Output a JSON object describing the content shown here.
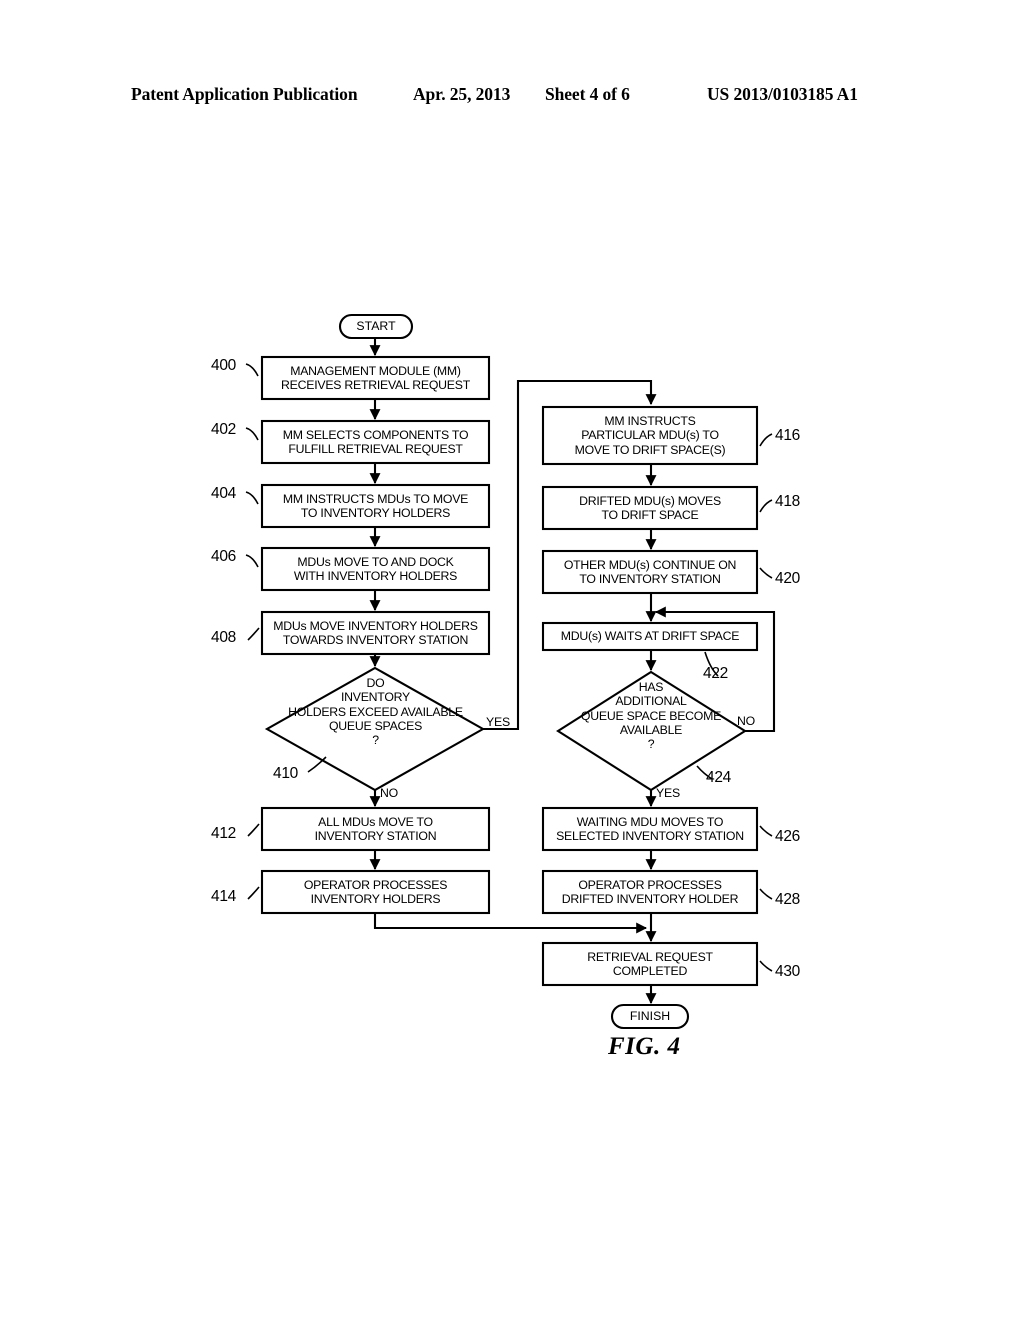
{
  "header": {
    "publication": "Patent Application Publication",
    "date": "Apr. 25, 2013",
    "sheet": "Sheet 4 of 6",
    "doc_number": "US 2013/0103185 A1"
  },
  "figure": {
    "caption": "FIG. 4",
    "start_label": "START",
    "finish_label": "FINISH"
  },
  "chart_data": {
    "type": "diagram",
    "title": "FIG. 4",
    "nodes": [
      {
        "ref": "",
        "shape": "terminal",
        "lines": [
          "START"
        ]
      },
      {
        "ref": "400",
        "shape": "process",
        "lines": [
          "MANAGEMENT MODULE (MM)",
          "RECEIVES RETRIEVAL REQUEST"
        ]
      },
      {
        "ref": "402",
        "shape": "process",
        "lines": [
          "MM SELECTS COMPONENTS TO",
          "FULFILL RETRIEVAL REQUEST"
        ]
      },
      {
        "ref": "404",
        "shape": "process",
        "lines": [
          "MM INSTRUCTS MDUs TO MOVE",
          "TO INVENTORY HOLDERS"
        ]
      },
      {
        "ref": "406",
        "shape": "process",
        "lines": [
          "MDUs MOVE TO AND DOCK",
          "WITH INVENTORY HOLDERS"
        ]
      },
      {
        "ref": "408",
        "shape": "process",
        "lines": [
          "MDUs MOVE INVENTORY HOLDERS",
          "TOWARDS INVENTORY STATION"
        ]
      },
      {
        "ref": "410",
        "shape": "decision",
        "lines": [
          "DO",
          "INVENTORY",
          "HOLDERS EXCEED AVAILABLE",
          "QUEUE SPACES",
          "?"
        ]
      },
      {
        "ref": "412",
        "shape": "process",
        "lines": [
          "ALL MDUs MOVE TO",
          "INVENTORY STATION"
        ]
      },
      {
        "ref": "414",
        "shape": "process",
        "lines": [
          "OPERATOR PROCESSES",
          "INVENTORY HOLDERS"
        ]
      },
      {
        "ref": "416",
        "shape": "process",
        "lines": [
          "MM INSTRUCTS",
          "PARTICULAR MDU(s) TO",
          "MOVE TO DRIFT SPACE(S)"
        ]
      },
      {
        "ref": "418",
        "shape": "process",
        "lines": [
          "DRIFTED MDU(s) MOVES",
          "TO DRIFT SPACE"
        ]
      },
      {
        "ref": "420",
        "shape": "process",
        "lines": [
          "OTHER MDU(s) CONTINUE ON",
          "TO INVENTORY STATION"
        ]
      },
      {
        "ref": "422",
        "shape": "process",
        "lines": [
          "MDU(s) WAITS AT DRIFT SPACE"
        ]
      },
      {
        "ref": "424",
        "shape": "decision",
        "lines": [
          "HAS",
          "ADDITIONAL",
          "QUEUE SPACE BECOME",
          "AVAILABLE",
          "?"
        ]
      },
      {
        "ref": "426",
        "shape": "process",
        "lines": [
          "WAITING MDU MOVES TO",
          "SELECTED INVENTORY STATION"
        ]
      },
      {
        "ref": "428",
        "shape": "process",
        "lines": [
          "OPERATOR PROCESSES",
          "DRIFTED INVENTORY HOLDER"
        ]
      },
      {
        "ref": "430",
        "shape": "process",
        "lines": [
          "RETRIEVAL REQUEST",
          "COMPLETED"
        ]
      },
      {
        "ref": "",
        "shape": "terminal",
        "lines": [
          "FINISH"
        ]
      }
    ],
    "edge_labels": [
      {
        "id": "yes410",
        "text": "YES"
      },
      {
        "id": "no410",
        "text": "NO"
      },
      {
        "id": "no424",
        "text": "NO"
      },
      {
        "id": "yes424",
        "text": "YES"
      }
    ],
    "ref_numbers": [
      "400",
      "402",
      "404",
      "406",
      "408",
      "410",
      "412",
      "414",
      "416",
      "418",
      "420",
      "422",
      "424",
      "426",
      "428",
      "430"
    ]
  },
  "nodes": {
    "n400": {
      "l1": "MANAGEMENT MODULE (MM)",
      "l2": "RECEIVES RETRIEVAL REQUEST",
      "ref": "400"
    },
    "n402": {
      "l1": "MM SELECTS COMPONENTS TO",
      "l2": "FULFILL RETRIEVAL REQUEST",
      "ref": "402"
    },
    "n404": {
      "l1": "MM INSTRUCTS MDUs TO MOVE",
      "l2": "TO INVENTORY HOLDERS",
      "ref": "404"
    },
    "n406": {
      "l1": "MDUs MOVE TO AND DOCK",
      "l2": "WITH INVENTORY HOLDERS",
      "ref": "406"
    },
    "n408": {
      "l1": "MDUs MOVE INVENTORY HOLDERS",
      "l2": "TOWARDS INVENTORY STATION",
      "ref": "408"
    },
    "n410": {
      "l1": "DO",
      "l2": "INVENTORY",
      "l3": "HOLDERS EXCEED AVAILABLE",
      "l4": "QUEUE SPACES",
      "l5": "?",
      "ref": "410"
    },
    "n412": {
      "l1": "ALL MDUs MOVE TO",
      "l2": "INVENTORY STATION",
      "ref": "412"
    },
    "n414": {
      "l1": "OPERATOR PROCESSES",
      "l2": "INVENTORY HOLDERS",
      "ref": "414"
    },
    "n416": {
      "l1": "MM INSTRUCTS",
      "l2": "PARTICULAR MDU(s) TO",
      "l3": "MOVE TO DRIFT SPACE(S)",
      "ref": "416"
    },
    "n418": {
      "l1": "DRIFTED MDU(s) MOVES",
      "l2": "TO DRIFT SPACE",
      "ref": "418"
    },
    "n420": {
      "l1": "OTHER MDU(s) CONTINUE ON",
      "l2": "TO INVENTORY STATION",
      "ref": "420"
    },
    "n422": {
      "l1": "MDU(s) WAITS AT DRIFT SPACE",
      "ref": "422"
    },
    "n424": {
      "l1": "HAS",
      "l2": "ADDITIONAL",
      "l3": "QUEUE SPACE BECOME",
      "l4": "AVAILABLE",
      "l5": "?",
      "ref": "424"
    },
    "n426": {
      "l1": "WAITING MDU MOVES TO",
      "l2": "SELECTED INVENTORY STATION",
      "ref": "426"
    },
    "n428": {
      "l1": "OPERATOR PROCESSES",
      "l2": "DRIFTED INVENTORY HOLDER",
      "ref": "428"
    },
    "n430": {
      "l1": "RETRIEVAL REQUEST",
      "l2": "COMPLETED",
      "ref": "430"
    }
  },
  "labels": {
    "yes_410": "YES",
    "no_410": "NO",
    "no_424": "NO",
    "yes_424": "YES"
  }
}
